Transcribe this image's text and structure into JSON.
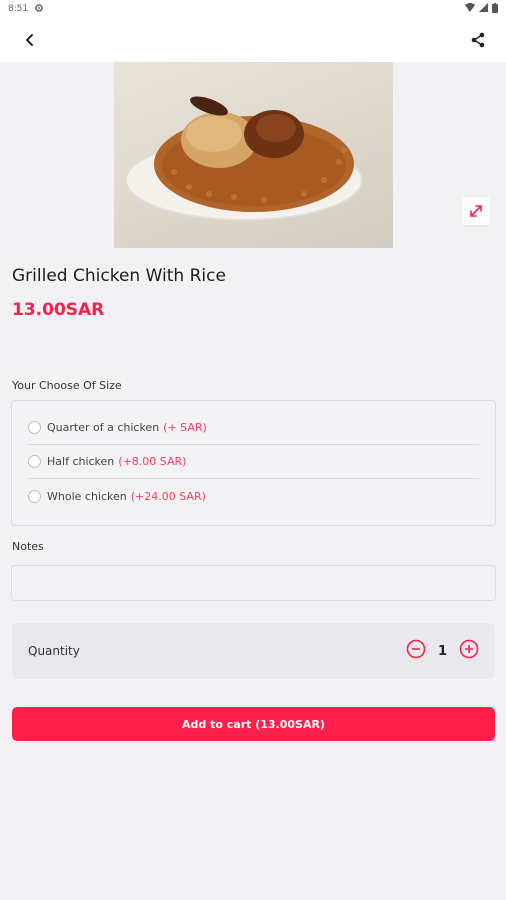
{
  "status_bar": {
    "time": "8:51"
  },
  "product": {
    "name": "Grilled Chicken With Rice",
    "price": "13.00SAR"
  },
  "size_section": {
    "label": "Your Choose Of Size",
    "options": [
      {
        "label": "Quarter of a chicken",
        "extra": "(+ SAR)"
      },
      {
        "label": "Half chicken",
        "extra": "(+8.00 SAR)"
      },
      {
        "label": "Whole chicken",
        "extra": "(+24.00 SAR)"
      }
    ]
  },
  "notes": {
    "label": "Notes",
    "value": "",
    "placeholder": ""
  },
  "quantity": {
    "label": "Quantity",
    "value": "1"
  },
  "cart_button": {
    "label": "Add to cart (13.00SAR)"
  },
  "colors": {
    "accent": "#ff1f4b",
    "background": "#f2f2f4"
  },
  "icons": [
    "settings-icon",
    "wifi-icon",
    "signal-icon",
    "battery-icon",
    "back-icon",
    "share-icon",
    "expand-icon",
    "minus-icon",
    "plus-icon"
  ]
}
